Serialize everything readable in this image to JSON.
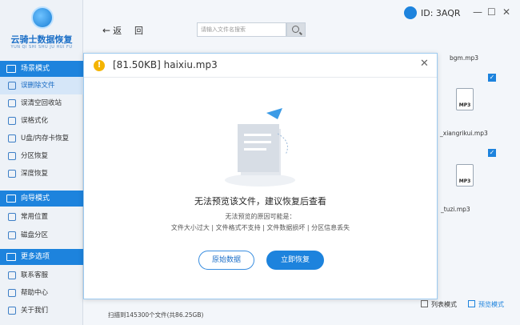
{
  "app": {
    "name": "云骑士数据恢复",
    "name_sub": "YUN QI SHI SHU JU HUI FU",
    "user_id": "ID: 3AQR"
  },
  "sidebar": {
    "section1": "场景模式",
    "section1_items": [
      "误删除文件",
      "误清空回收站",
      "误格式化",
      "U盘/内存卡恢复",
      "分区恢复",
      "深度恢复"
    ],
    "section2": "向导模式",
    "section2_items": [
      "常用位置",
      "磁盘分区"
    ],
    "section3": "更多选项",
    "section3_items": [
      "联系客服",
      "帮助中心",
      "关于我们"
    ]
  },
  "toolbar": {
    "back_label": "返",
    "back_label2": "回",
    "search_placeholder": "请输入文件名搜索"
  },
  "files": [
    {
      "name": "bgm.mp3"
    },
    {
      "name": "_xiangrikui.mp3"
    },
    {
      "name": "_tuzi.mp3"
    }
  ],
  "file_icon_label": "MP3",
  "status_text": "扫描到145300个文件(共86.25GB)",
  "view_modes": [
    "列表模式",
    "预览模式"
  ],
  "modal": {
    "title": "[81.50KB] haixiu.mp3",
    "main_message": "无法预览该文件，建议恢复后查看",
    "reason_heading": "无法预览的原因可能是：",
    "reasons": "文件大小过大 | 文件格式不支持 | 文件数据损坏 | 分区信息丢失",
    "btn_raw": "原始数据",
    "btn_recover": "立即恢复"
  },
  "colors": {
    "accent": "#1d83dd",
    "warn": "#f4b400"
  }
}
